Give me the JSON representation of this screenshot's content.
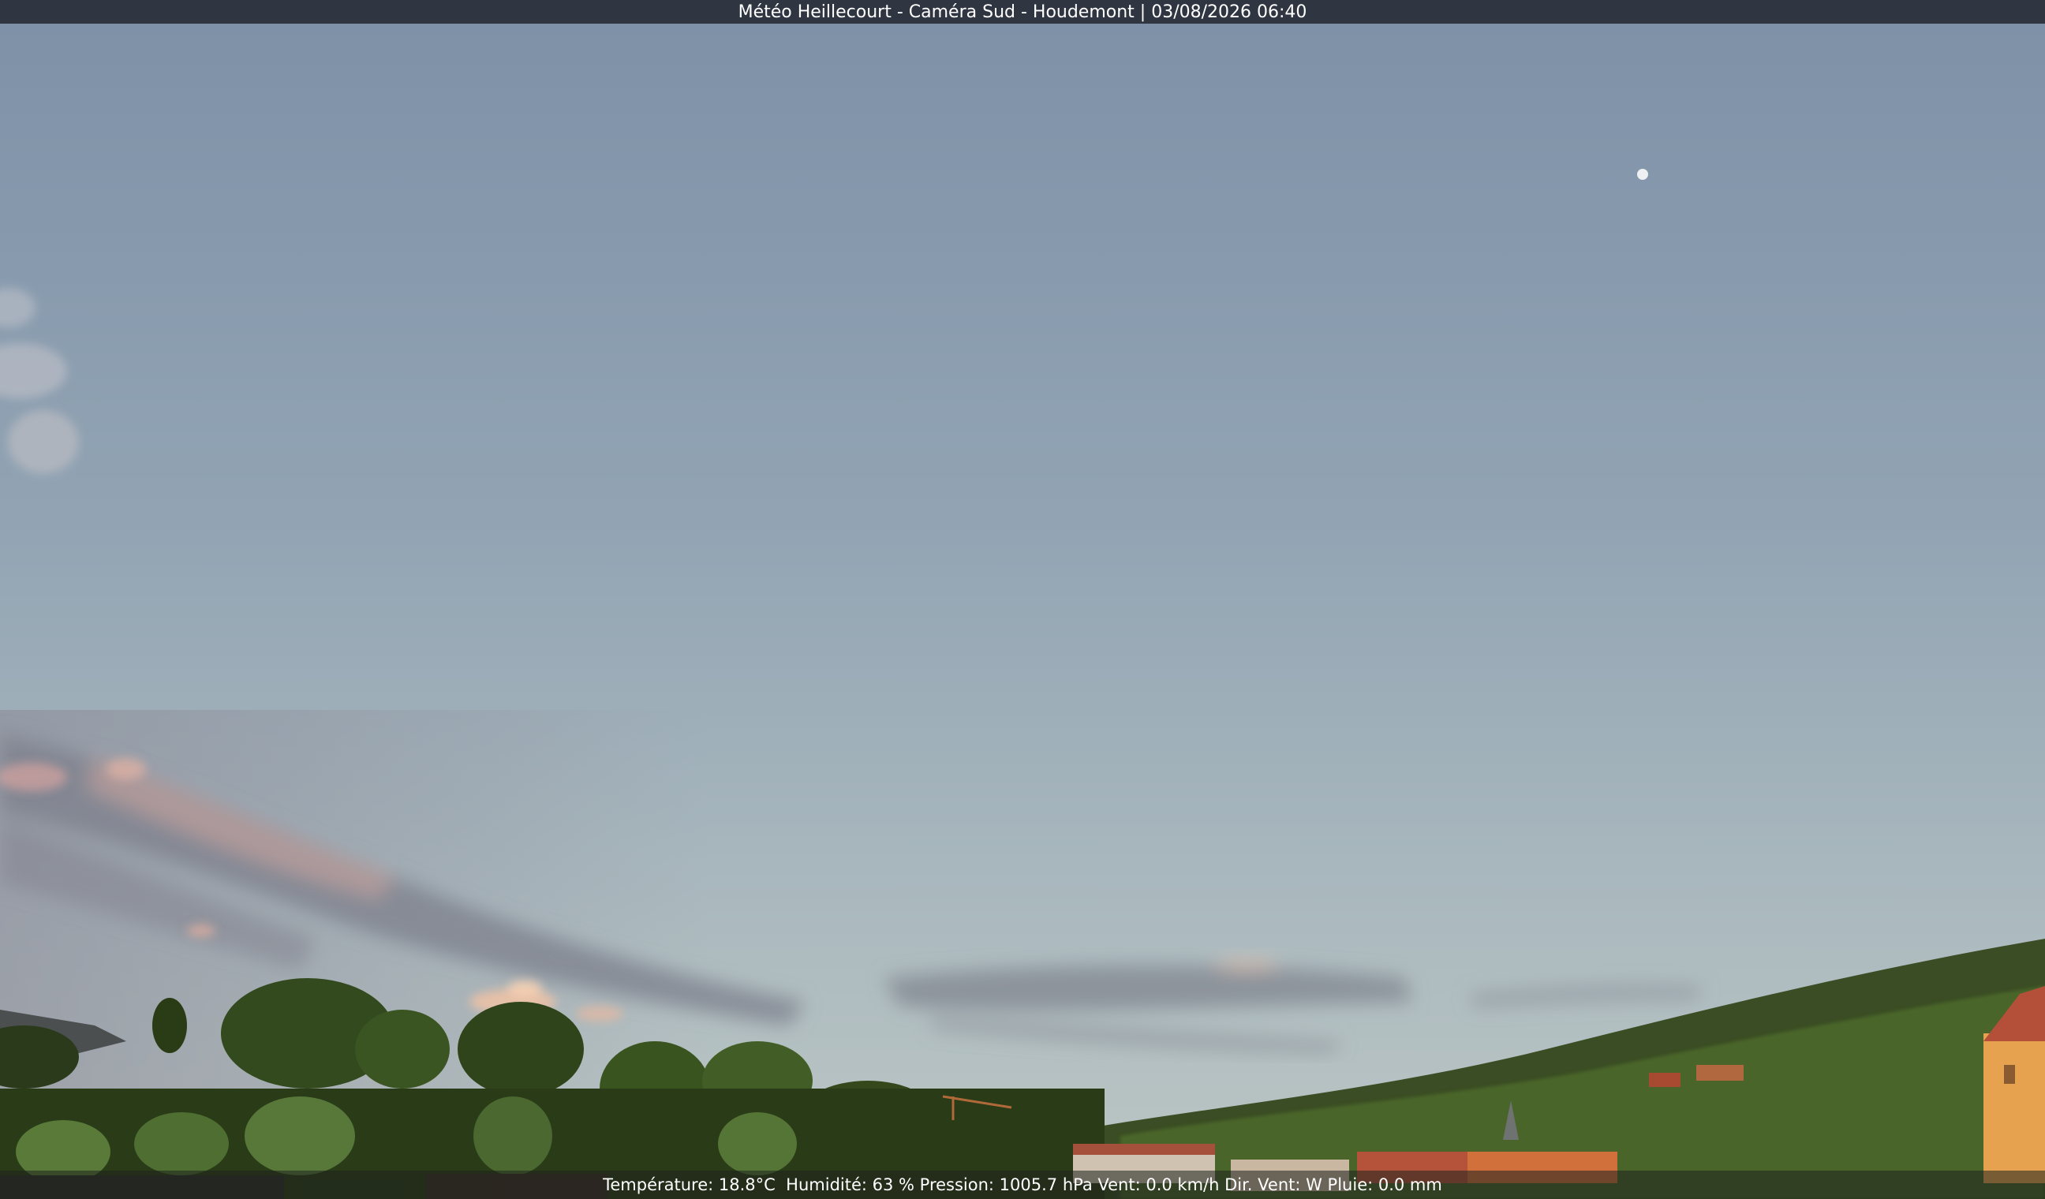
{
  "header": {
    "title": "Météo Heillecourt - Caméra Sud - Houdemont | 03/08/2026 06:40"
  },
  "footer": {
    "weather_line": "Température: 18.8°C  Humidité: 63 % Pression: 1005.7 hPa Vent: 0.0 km/h Dir. Vent: W Pluie: 0.0 mm"
  },
  "colors": {
    "sky_top": "#7f92a8",
    "sky_mid": "#98a9b5",
    "sky_horizon": "#b7c3c4",
    "cloud_dark": "#7e838e",
    "cloud_pink": "#e8b8a4",
    "trees_dark": "#1f2e14",
    "trees_mid": "#3c5526",
    "trees_light": "#5d7a38",
    "roofs": "#a8503a",
    "facade": "#e8a050"
  },
  "icons": {
    "moon": "moon-icon"
  }
}
